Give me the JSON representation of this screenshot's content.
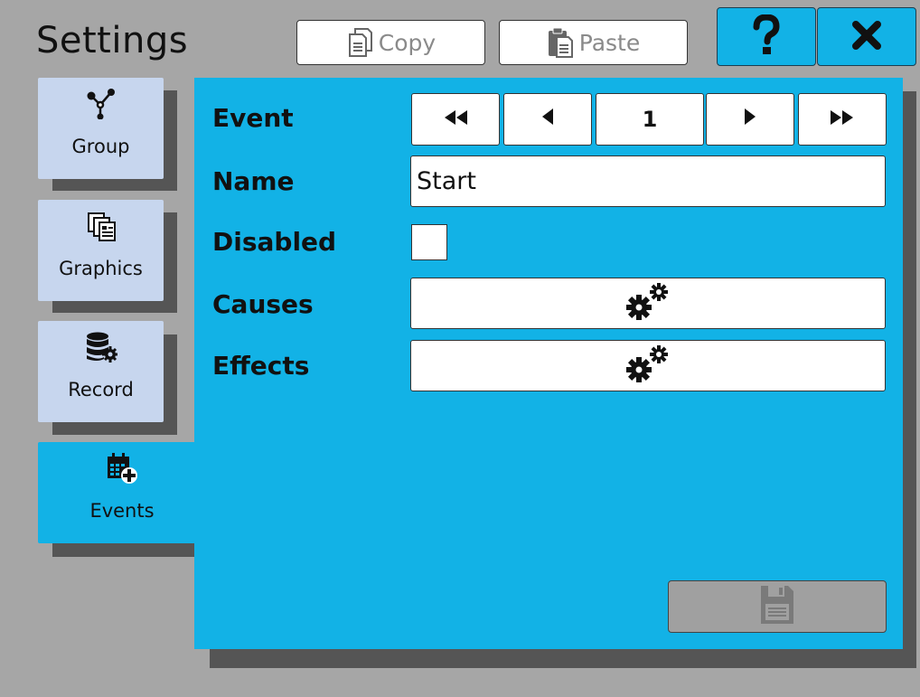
{
  "window": {
    "title": "Settings"
  },
  "toolbar": {
    "copy_label": "Copy",
    "paste_label": "Paste",
    "copy_icon": "copy-icon",
    "paste_icon": "clipboard-icon",
    "help_icon": "question-mark-icon",
    "close_icon": "close-icon"
  },
  "sidebar": {
    "tabs": [
      {
        "label": "Group",
        "icon": "network-nodes-icon",
        "active": false
      },
      {
        "label": "Graphics",
        "icon": "graphics-pages-icon",
        "active": false
      },
      {
        "label": "Record",
        "icon": "database-gear-icon",
        "active": false
      },
      {
        "label": "Events",
        "icon": "calendar-add-icon",
        "active": true
      }
    ]
  },
  "form": {
    "event_label": "Event",
    "event_number": "1",
    "event_nav_icons": [
      "first-icon",
      "previous-icon",
      "next-icon",
      "last-icon"
    ],
    "name_label": "Name",
    "name_value": "Start",
    "disabled_label": "Disabled",
    "disabled_checked": false,
    "causes_label": "Causes",
    "effects_label": "Effects",
    "causes_icon": "gears-icon",
    "effects_icon": "gears-icon",
    "save_icon": "save-icon",
    "save_enabled": false
  },
  "colors": {
    "accent": "#12b2e6",
    "background": "#a6a6a6",
    "tab_inactive": "#c7d6ee",
    "disabled_gray": "#a0a0a0"
  }
}
